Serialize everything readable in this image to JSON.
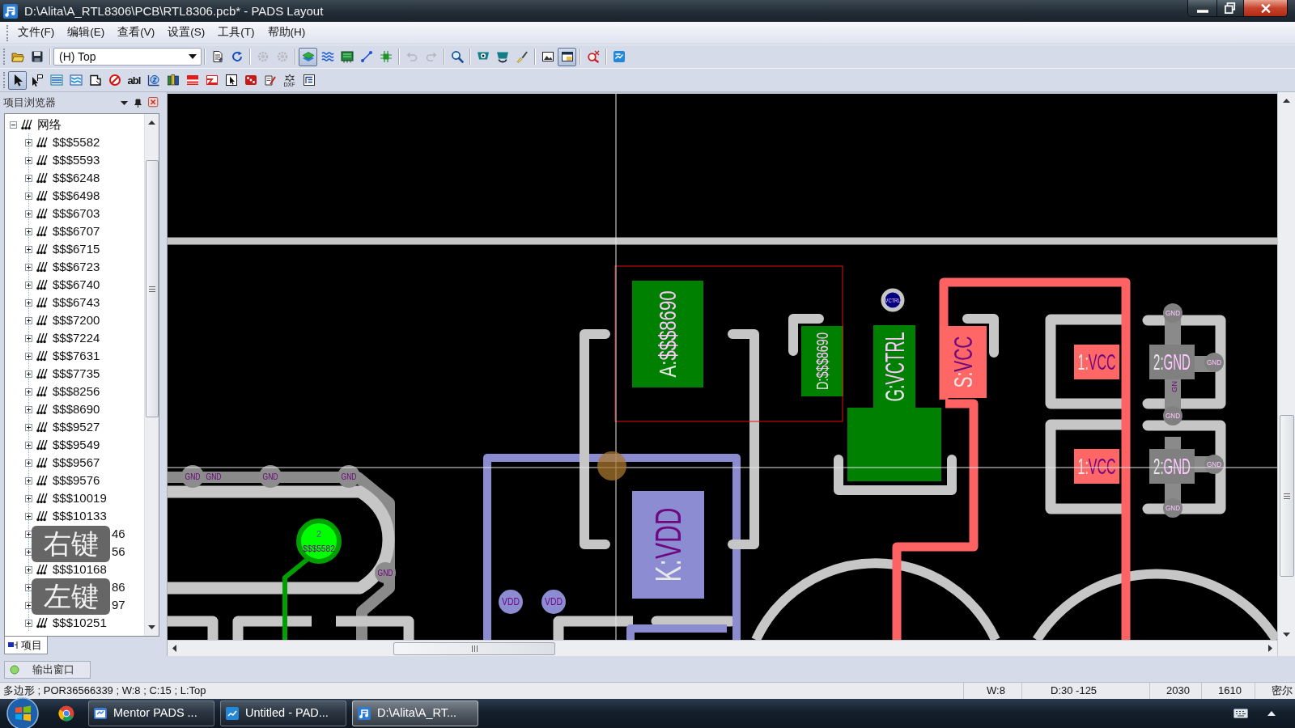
{
  "window": {
    "title": "D:\\Alita\\A_RTL8306\\PCB\\RTL8306.pcb* - PADS Layout"
  },
  "menu": [
    {
      "label": "文件(F)"
    },
    {
      "label": "编辑(E)"
    },
    {
      "label": "查看(V)"
    },
    {
      "label": "设置(S)"
    },
    {
      "label": "工具(T)"
    },
    {
      "label": "帮助(H)"
    }
  ],
  "toolbars": [
    {
      "items": [
        {
          "kind": "button",
          "pressed": false,
          "disabled": false
        },
        {
          "kind": "button",
          "pressed": false,
          "disabled": false
        },
        {
          "kind": "separator"
        },
        {
          "kind": "dropdown",
          "value": "(H) Top"
        },
        {
          "kind": "separator"
        },
        {
          "kind": "button",
          "pressed": false,
          "disabled": false
        },
        {
          "kind": "button",
          "pressed": false,
          "disabled": false
        },
        {
          "kind": "separator"
        },
        {
          "kind": "button",
          "pressed": false,
          "disabled": true
        },
        {
          "kind": "button",
          "pressed": false,
          "disabled": true
        },
        {
          "kind": "separator"
        },
        {
          "kind": "button",
          "pressed": true,
          "disabled": false
        },
        {
          "kind": "button",
          "pressed": false,
          "disabled": false
        },
        {
          "kind": "button",
          "pressed": false,
          "disabled": false
        },
        {
          "kind": "button",
          "pressed": false,
          "disabled": false
        },
        {
          "kind": "button",
          "pressed": false,
          "disabled": false
        },
        {
          "kind": "separator"
        },
        {
          "kind": "button",
          "pressed": false,
          "disabled": true
        },
        {
          "kind": "button",
          "pressed": false,
          "disabled": true
        },
        {
          "kind": "separator"
        },
        {
          "kind": "button",
          "pressed": false,
          "disabled": false
        },
        {
          "kind": "separator"
        },
        {
          "kind": "button",
          "pressed": false,
          "disabled": false
        },
        {
          "kind": "button",
          "pressed": false,
          "disabled": false
        },
        {
          "kind": "button",
          "pressed": false,
          "disabled": false
        },
        {
          "kind": "separator"
        },
        {
          "kind": "button",
          "pressed": false,
          "disabled": false
        },
        {
          "kind": "button",
          "pressed": true,
          "disabled": false
        },
        {
          "kind": "separator"
        },
        {
          "kind": "button",
          "pressed": false,
          "disabled": false
        },
        {
          "kind": "separator"
        },
        {
          "kind": "button",
          "pressed": false,
          "disabled": false
        }
      ]
    },
    {
      "items": [
        {
          "kind": "button",
          "pressed": true,
          "disabled": false
        },
        {
          "kind": "button",
          "pressed": false,
          "disabled": false
        },
        {
          "kind": "button",
          "pressed": false,
          "disabled": false
        },
        {
          "kind": "button",
          "pressed": false,
          "disabled": false
        },
        {
          "kind": "button",
          "pressed": false,
          "disabled": false
        },
        {
          "kind": "button",
          "pressed": false,
          "disabled": false
        },
        {
          "kind": "button",
          "text": "abl",
          "pressed": false,
          "disabled": false
        },
        {
          "kind": "button",
          "pressed": false,
          "disabled": false
        },
        {
          "kind": "button",
          "pressed": false,
          "disabled": false
        },
        {
          "kind": "button",
          "pressed": false,
          "disabled": false
        },
        {
          "kind": "button",
          "pressed": false,
          "disabled": false
        },
        {
          "kind": "button",
          "pressed": false,
          "disabled": false
        },
        {
          "kind": "button",
          "pressed": false,
          "disabled": false
        },
        {
          "kind": "button",
          "pressed": false,
          "disabled": false
        },
        {
          "kind": "button",
          "text": "DXF",
          "pressed": false,
          "disabled": false
        },
        {
          "kind": "button",
          "pressed": false,
          "disabled": false
        }
      ]
    }
  ],
  "project_browser": {
    "title": "项目浏览器",
    "tree": [
      {
        "label": "网络",
        "expanded": true,
        "children": [
          {
            "label": "$$$5582",
            "expanded": false
          },
          {
            "label": "$$$5593",
            "expanded": false
          },
          {
            "label": "$$$6248",
            "expanded": false
          },
          {
            "label": "$$$6498",
            "expanded": false
          },
          {
            "label": "$$$6703",
            "expanded": false
          },
          {
            "label": "$$$6707",
            "expanded": false
          },
          {
            "label": "$$$6715",
            "expanded": false
          },
          {
            "label": "$$$6723",
            "expanded": false
          },
          {
            "label": "$$$6740",
            "expanded": false
          },
          {
            "label": "$$$6743",
            "expanded": false
          },
          {
            "label": "$$$7200",
            "expanded": false
          },
          {
            "label": "$$$7224",
            "expanded": false
          },
          {
            "label": "$$$7631",
            "expanded": false
          },
          {
            "label": "$$$7735",
            "expanded": false
          },
          {
            "label": "$$$8256",
            "expanded": false
          },
          {
            "label": "$$$8690",
            "expanded": false
          },
          {
            "label": "$$$9527",
            "expanded": false
          },
          {
            "label": "$$$9549",
            "expanded": false
          },
          {
            "label": "$$$9567",
            "expanded": false
          },
          {
            "label": "$$$9576",
            "expanded": false
          },
          {
            "label": "$$$10019",
            "expanded": false
          },
          {
            "label": "$$$10133",
            "expanded": false
          },
          {
            "label": "46",
            "expanded": false
          },
          {
            "label": "56",
            "expanded": false
          },
          {
            "label": "$$$10168",
            "expanded": false
          },
          {
            "label": "86",
            "expanded": false
          },
          {
            "label": "97",
            "expanded": false
          },
          {
            "label": "$$$10251",
            "expanded": false
          }
        ]
      }
    ],
    "tabs": [
      {
        "label": "项目",
        "selected": true
      }
    ]
  },
  "key_overlays": [
    {
      "text": "右键"
    },
    {
      "text": "左键"
    }
  ],
  "canvas": {
    "pads": [
      {
        "pin": "A:",
        "net": "$$$8690",
        "color": "#008000"
      },
      {
        "pin": "K:",
        "net": "VDD",
        "color": "#8c8cd2"
      },
      {
        "pin": "D:",
        "net": "$$$8690",
        "color": "#008000"
      },
      {
        "pin": "G:",
        "net": "VCTRL",
        "color": "#008000"
      },
      {
        "color": "#008000"
      },
      {
        "pin": "S:",
        "net": "VCC",
        "color": "#ff6666"
      },
      {
        "pin": "1:",
        "net": "VCC",
        "color": "#ff6666"
      },
      {
        "pin": "1:",
        "net": "VCC",
        "color": "#ff6666"
      },
      {
        "pin": "2:",
        "net": "GND",
        "color": "#808080"
      },
      {
        "pin": "2:",
        "net": "GND",
        "color": "#808080"
      }
    ],
    "vias": [
      {
        "net": "GND",
        "color": "#8c8c8c"
      },
      {
        "net": "GND",
        "color": "#8c8c8c"
      },
      {
        "net": "GND",
        "color": "#8c8c8c"
      },
      {
        "net": "GND",
        "color": "#8c8c8c"
      },
      {
        "pin": "2",
        "net": "$$$5582",
        "color": "#00ff00"
      },
      {
        "net": "VDD",
        "color": "#8c8cd2"
      },
      {
        "net": "VDD",
        "color": "#8c8cd2"
      },
      {
        "net": "VCTRL",
        "color": "#000080"
      },
      {
        "net": "GND",
        "color": "#808080"
      },
      {
        "net": "GND",
        "color": "#808080"
      },
      {
        "net": "GND",
        "color": "#808080"
      },
      {
        "net": "GND",
        "color": "#808080"
      },
      {
        "net": "GND",
        "color": "#808080"
      }
    ],
    "labels": [
      {
        "text": "GND"
      },
      {
        "text": "GN"
      }
    ]
  },
  "output_tab": {
    "label": "输出窗口"
  },
  "status_bar": {
    "message": "多边形 ; POR36566339 ; W:8 ; C:15 ; L:Top",
    "fields": [
      "W:8",
      "D:30 -125",
      "2030",
      "1610",
      "密尔"
    ]
  },
  "taskbar": {
    "buttons": [
      {
        "label": "Mentor PADS ...",
        "selected": false
      },
      {
        "label": "Untitled - PAD...",
        "selected": false
      },
      {
        "label": "D:\\Alita\\A_RT...",
        "selected": true
      }
    ]
  }
}
